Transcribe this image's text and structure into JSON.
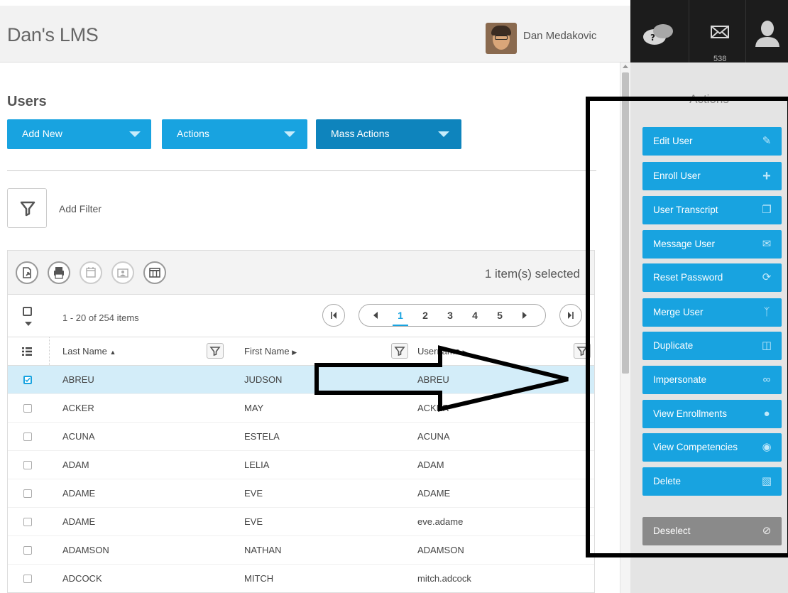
{
  "app": {
    "title": "Dan's LMS",
    "user_name": "Dan Medakovic"
  },
  "topbar": {
    "mail_count": "538"
  },
  "page": {
    "title": "Users"
  },
  "toolbar": {
    "add_new": "Add New",
    "actions": "Actions",
    "mass_actions": "Mass Actions"
  },
  "filter": {
    "label": "Add Filter"
  },
  "grid": {
    "selected_text": "1 item(s) selected",
    "items_text": "1 - 20 of 254 items",
    "pages": [
      "1",
      "2",
      "3",
      "4",
      "5"
    ],
    "current_page": "1",
    "columns": {
      "last_name": "Last Name",
      "first_name": "First Name",
      "username": "Username"
    },
    "rows": [
      {
        "last": "ABREU",
        "first": "JUDSON",
        "user": "ABREU",
        "selected": true
      },
      {
        "last": "ACKER",
        "first": "MAY",
        "user": "ACKER",
        "selected": false
      },
      {
        "last": "ACUNA",
        "first": "ESTELA",
        "user": "ACUNA",
        "selected": false
      },
      {
        "last": "ADAM",
        "first": "LELIA",
        "user": "ADAM",
        "selected": false
      },
      {
        "last": "ADAME",
        "first": "EVE",
        "user": "ADAME",
        "selected": false
      },
      {
        "last": "ADAME",
        "first": "EVE",
        "user": "eve.adame",
        "selected": false
      },
      {
        "last": "ADAMSON",
        "first": "NATHAN",
        "user": "ADAMSON",
        "selected": false
      },
      {
        "last": "ADCOCK",
        "first": "MITCH",
        "user": "mitch.adcock",
        "selected": false
      }
    ]
  },
  "side": {
    "title": "Actions",
    "actions": [
      {
        "label": "Edit User",
        "icon": "pencil-icon"
      },
      {
        "label": "Enroll User",
        "icon": "plus-icon"
      },
      {
        "label": "User Transcript",
        "icon": "document-icon"
      },
      {
        "label": "Message User",
        "icon": "envelope-icon"
      },
      {
        "label": "Reset Password",
        "icon": "refresh-icon"
      },
      {
        "label": "Merge User",
        "icon": "merge-icon"
      },
      {
        "label": "Duplicate",
        "icon": "duplicate-icon"
      },
      {
        "label": "Impersonate",
        "icon": "mask-icon"
      },
      {
        "label": "View Enrollments",
        "icon": "person-icon"
      },
      {
        "label": "View Competencies",
        "icon": "shield-icon"
      },
      {
        "label": "Delete",
        "icon": "trash-icon"
      }
    ],
    "deselect": {
      "label": "Deselect",
      "icon": "ban-icon"
    }
  },
  "colors": {
    "accent": "#18a3e0",
    "accent_dark": "#0e84bd",
    "selected_row": "#d3edf9",
    "topbar_dark": "#1c1c1c"
  }
}
